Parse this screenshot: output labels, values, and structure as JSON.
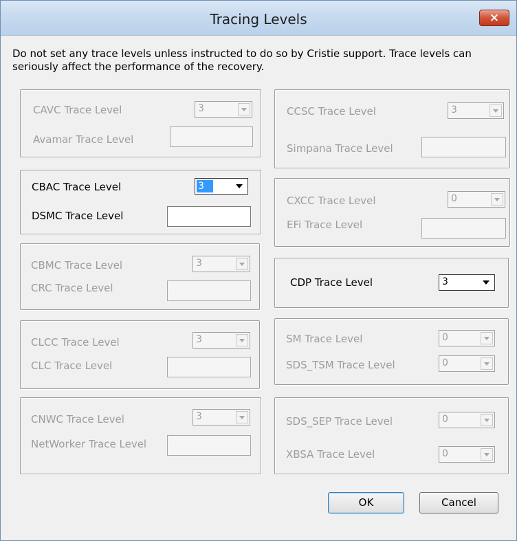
{
  "dialog": {
    "title": "Tracing Levels",
    "close_label": "×",
    "note": "Do not set any trace levels unless instructed to do so by Cristie support. Trace levels can seriously affect the performance of the recovery."
  },
  "groups": {
    "cavc": {
      "combo_label": "CAVC Trace Level",
      "combo_value": "3",
      "field_label": "Avamar Trace Level",
      "field_value": ""
    },
    "cbac": {
      "combo_label": "CBAC Trace Level",
      "combo_value": "3",
      "field_label": "DSMC Trace Level",
      "field_value": ""
    },
    "cbmc": {
      "combo_label": "CBMC Trace Level",
      "combo_value": "3",
      "field_label": "CRC Trace Level",
      "field_value": ""
    },
    "clcc": {
      "combo_label": "CLCC Trace Level",
      "combo_value": "3",
      "field_label": "CLC Trace Level",
      "field_value": ""
    },
    "cnwc": {
      "combo_label": "CNWC Trace Level",
      "combo_value": "3",
      "field_label": "NetWorker Trace Level",
      "field_value": ""
    },
    "ccsc": {
      "combo_label": "CCSC Trace Level",
      "combo_value": "3",
      "field_label": "Simpana Trace Level",
      "field_value": ""
    },
    "cxcc": {
      "combo_label": "CXCC Trace Level",
      "combo_value": "0",
      "field_label": "EFi Trace Level",
      "field_value": ""
    },
    "cdp": {
      "combo_label": "CDP Trace Level",
      "combo_value": "3"
    },
    "sm": {
      "combo1_label": "SM Trace Level",
      "combo1_value": "0",
      "combo2_label": "SDS_TSM Trace Level",
      "combo2_value": "0"
    },
    "sds_sep": {
      "combo1_label": "SDS_SEP Trace Level",
      "combo1_value": "0",
      "combo2_label": "XBSA Trace Level",
      "combo2_value": "0"
    }
  },
  "buttons": {
    "ok": "OK",
    "cancel": "Cancel"
  }
}
